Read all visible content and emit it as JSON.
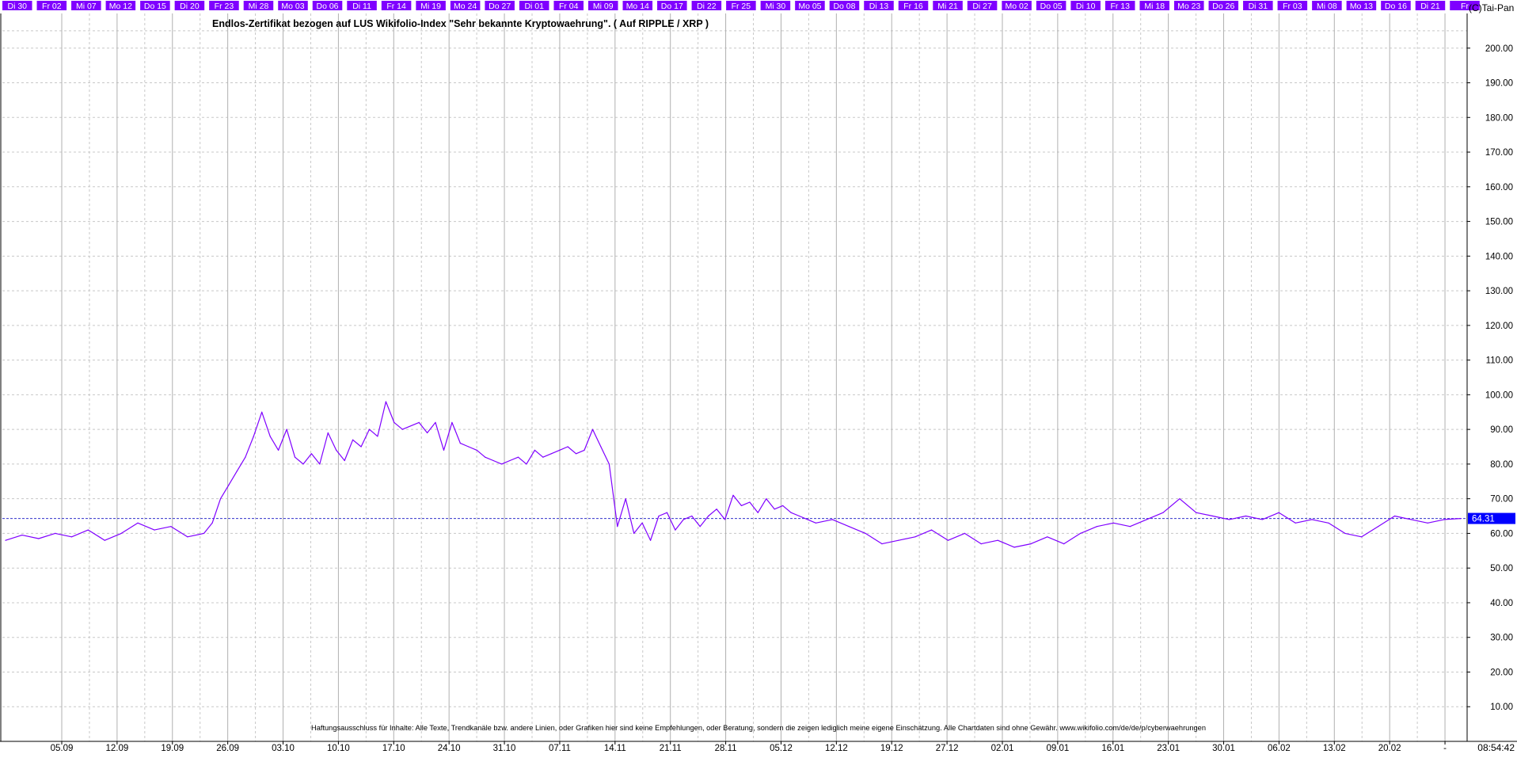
{
  "copyright": "(C)Tai-Pan",
  "disclaimer": "Haftungsausschluss für Inhalte: Alle Texte, Trendkanäle bzw. andere Linien, oder Grafiken hier sind keine Empfehlungen, oder Beratung, sondern die zeigen lediglich meine eigene Einschätzung. Alle Chartdaten sind ohne Gewähr. www.wikifolio.com/de/de/p/cyberwaehrungen",
  "time": "08:54:42",
  "colors": {
    "line": "#7f00ff",
    "top_bar": "#7f00ff",
    "last_badge": "#0000ff",
    "ref_line": "#3333cc",
    "grid": "#c8c8c8"
  },
  "top_dates": [
    "Di 30",
    "Fr 02",
    "Mi 07",
    "Mo 12",
    "Do 15",
    "Di 20",
    "Fr 23",
    "Mi 28",
    "Mo 03",
    "Do 06",
    "Di 11",
    "Fr 14",
    "Mi 19",
    "Mo 24",
    "Do 27",
    "Di 01",
    "Fr 04",
    "Mi 09",
    "Mo 14",
    "Do 17",
    "Di 22",
    "Fr 25",
    "Mi 30",
    "Mo 05",
    "Do 08",
    "Di 13",
    "Fr 16",
    "Mi 21",
    "Di 27",
    "Mo 02",
    "Do 05",
    "Di 10",
    "Fr 13",
    "Mi 18",
    "Mo 23",
    "Do 26",
    "Di 31",
    "Fr 03",
    "Mi 08",
    "Mo 13",
    "Do 16",
    "Di 21",
    "Fr"
  ],
  "chart_data": {
    "type": "line",
    "title": "Endlos-Zertifikat bezogen auf LUS Wikifolio-Index \"Sehr bekannte Kryptowaehrung\". ( Auf RIPPLE / XRP )",
    "last_value_label": "64.31",
    "last_value": 64.31,
    "ylim": [
      0,
      210
    ],
    "y_ticks": [
      "10.00",
      "20.00",
      "30.00",
      "40.00",
      "50.00",
      "60.00",
      "70.00",
      "80.00",
      "90.00",
      "100.00",
      "110.00",
      "120.00",
      "130.00",
      "140.00",
      "150.00",
      "160.00",
      "170.00",
      "180.00",
      "190.00",
      "200.00"
    ],
    "x_ticks": [
      "05.09",
      "12.09",
      "19.09",
      "26.09",
      "03.10",
      "10.10",
      "17.10",
      "24.10",
      "31.10",
      "07.11",
      "14.11",
      "21.11",
      "28.11",
      "05.12",
      "12.12",
      "19.12",
      "27.12",
      "02.01",
      "09.01",
      "16.01",
      "23.01",
      "30.01",
      "06.02",
      "13.02",
      "20.02",
      "-"
    ],
    "grid": true,
    "series": [
      {
        "x": [
          0,
          2,
          4,
          6,
          8,
          10,
          12,
          14,
          16,
          18,
          20,
          22,
          24,
          25,
          26,
          27,
          28,
          29,
          30,
          31,
          32,
          33,
          34,
          35,
          36,
          37,
          38,
          39,
          40,
          41,
          42,
          43,
          44,
          45,
          46,
          47,
          48,
          50,
          51,
          52,
          53,
          54,
          55,
          56,
          57,
          58,
          59,
          60,
          61,
          62,
          63,
          64,
          65,
          66,
          67,
          68,
          69,
          70,
          71,
          72,
          73,
          74,
          75,
          76,
          77,
          78,
          79,
          80,
          81,
          82,
          83,
          84,
          85,
          86,
          87,
          88,
          89,
          90,
          91,
          92,
          93,
          94,
          95,
          96,
          97,
          98,
          100,
          102,
          104,
          106,
          108,
          110,
          112,
          114,
          116,
          118,
          120,
          122,
          124,
          126,
          128,
          130,
          132,
          134,
          136,
          138,
          140,
          142,
          144,
          146,
          148,
          150,
          152,
          154,
          156,
          158,
          160,
          162,
          164,
          166,
          168,
          170,
          172,
          174,
          176
        ],
        "y": [
          58,
          59.5,
          58.5,
          60,
          59,
          61,
          58,
          60,
          63,
          61,
          62,
          59,
          60,
          63,
          70,
          74,
          78,
          82,
          88,
          95,
          88,
          84,
          90,
          82,
          80,
          83,
          80,
          89,
          84,
          81,
          87,
          85,
          90,
          88,
          98,
          92,
          90,
          92,
          89,
          92,
          84,
          92,
          86,
          85,
          84,
          82,
          81,
          80,
          81,
          82,
          80,
          84,
          82,
          83,
          84,
          85,
          83,
          84,
          90,
          85,
          80,
          62,
          70,
          60,
          63,
          58,
          65,
          66,
          61,
          64,
          65,
          62,
          65,
          67,
          64,
          71,
          68,
          69,
          66,
          70,
          67,
          68,
          66,
          65,
          64,
          63,
          64,
          62,
          60,
          57,
          58,
          59,
          61,
          58,
          60,
          57,
          58,
          56,
          57,
          59,
          57,
          60,
          62,
          63,
          62,
          64,
          66,
          70,
          66,
          65,
          64,
          65,
          64,
          66,
          63,
          64,
          63,
          60,
          59,
          62,
          65,
          64,
          63,
          64,
          64.31
        ]
      }
    ]
  }
}
